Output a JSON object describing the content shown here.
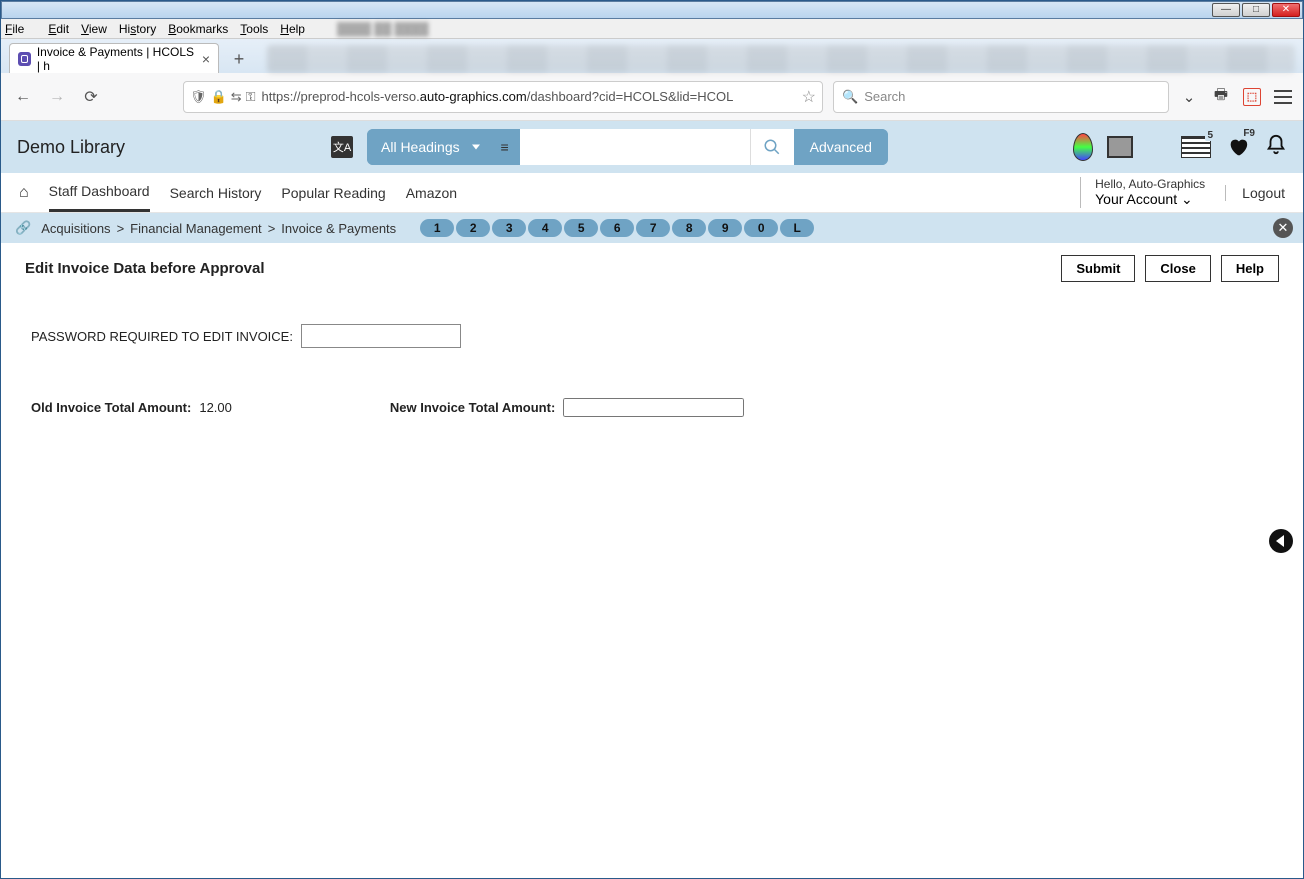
{
  "os": {
    "min": "—",
    "max": "□",
    "close": "✕"
  },
  "menu": {
    "file": "File",
    "edit": "Edit",
    "view": "View",
    "history": "History",
    "bookmarks": "Bookmarks",
    "tools": "Tools",
    "help": "Help"
  },
  "tabs": {
    "title": "Invoice & Payments | HCOLS | h"
  },
  "url": {
    "prefix": "https://preprod-hcols-verso.",
    "host": "auto-graphics.com",
    "path": "/dashboard?cid=HCOLS&lid=HCOL",
    "search_placeholder": "Search"
  },
  "header": {
    "library_name": "Demo Library",
    "search_scope": "All Headings",
    "advanced": "Advanced",
    "receipt_badge": "5",
    "heart_badge": "F9"
  },
  "nav": {
    "items": [
      "Staff Dashboard",
      "Search History",
      "Popular Reading",
      "Amazon"
    ],
    "hello": "Hello, Auto-Graphics",
    "account": "Your Account",
    "logout": "Logout"
  },
  "breadcrumb": {
    "parts": [
      "Acquisitions",
      "Financial Management",
      "Invoice & Payments"
    ],
    "pills": [
      "1",
      "2",
      "3",
      "4",
      "5",
      "6",
      "7",
      "8",
      "9",
      "0",
      "L"
    ]
  },
  "page": {
    "title": "Edit Invoice Data before Approval",
    "submit": "Submit",
    "close": "Close",
    "help": "Help",
    "password_label": "PASSWORD REQUIRED TO EDIT INVOICE:",
    "old_total_label": "Old Invoice Total Amount:",
    "old_total_value": "12.00",
    "new_total_label": "New Invoice Total Amount:"
  }
}
